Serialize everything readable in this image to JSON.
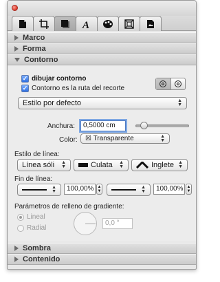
{
  "tabs": [
    {
      "icon": "document-icon"
    },
    {
      "icon": "crop-icon"
    },
    {
      "icon": "shadow-square-icon"
    },
    {
      "icon": "font-icon"
    },
    {
      "icon": "color-palette-icon"
    },
    {
      "icon": "metrics-icon"
    },
    {
      "icon": "image-icon"
    }
  ],
  "sections": {
    "marco": "Marco",
    "forma": "Forma",
    "contorno": "Contorno",
    "sombra": "Sombra",
    "contenido": "Contenido"
  },
  "contorno": {
    "draw_stroke_label": "dibujar contorno",
    "draw_stroke_checked": true,
    "stroke_is_path_label": "Contorno es la ruta del recorte",
    "stroke_is_path_checked": true,
    "style_preset": "Estilo por defecto",
    "width_label": "Anchura:",
    "width_value": "0,5000 cm",
    "width_slider_fraction": 0.15,
    "color_label": "Color:",
    "color_value": "☒ Transparente",
    "line_style_label": "Estilo de línea:",
    "line_style_value": "Línea sóli",
    "cap_value": "Culata",
    "join_value": "Inglete",
    "line_end_label": "Fin de línea:",
    "start_percent": "100,00%",
    "end_percent": "100,00%",
    "gradient_label": "Parámetros de relleno de gradiente:",
    "linear_label": "Lineal",
    "radial_label": "Radial",
    "angle_value": "0,0 °"
  }
}
